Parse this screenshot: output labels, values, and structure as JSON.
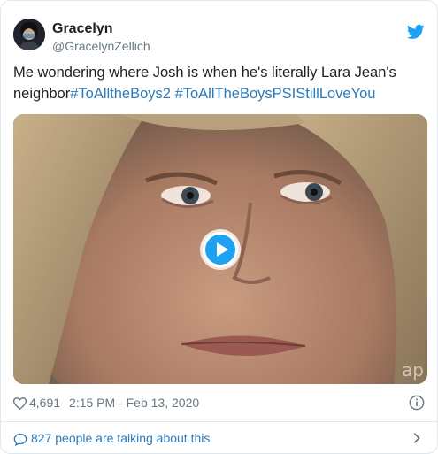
{
  "author": {
    "display_name": "Gracelyn",
    "handle": "@GracelynZellich",
    "avatar_icon": "user-avatar"
  },
  "tweet": {
    "text_plain": "Me wondering where Josh is when he's literally Lara Jean's neighbor",
    "hashtags": [
      "#ToAlltheBoys2",
      "#ToAllTheBoysPSIStillLoveYou"
    ]
  },
  "media": {
    "type": "gif-video",
    "play_icon": "play-icon",
    "watermark": "ap"
  },
  "meta": {
    "likes": "4,691",
    "timestamp": "2:15 PM - Feb 13, 2020",
    "heart_icon": "heart-icon",
    "info_icon": "info-icon"
  },
  "footer": {
    "conversation_label": "827 people are talking about this",
    "bubble_icon": "speech-bubble-icon",
    "chevron_icon": "chevron-right-icon"
  },
  "colors": {
    "link": "#2b7bb9",
    "twitter_blue": "#1da1f2",
    "muted": "#697882",
    "border": "#e1e8ed"
  }
}
